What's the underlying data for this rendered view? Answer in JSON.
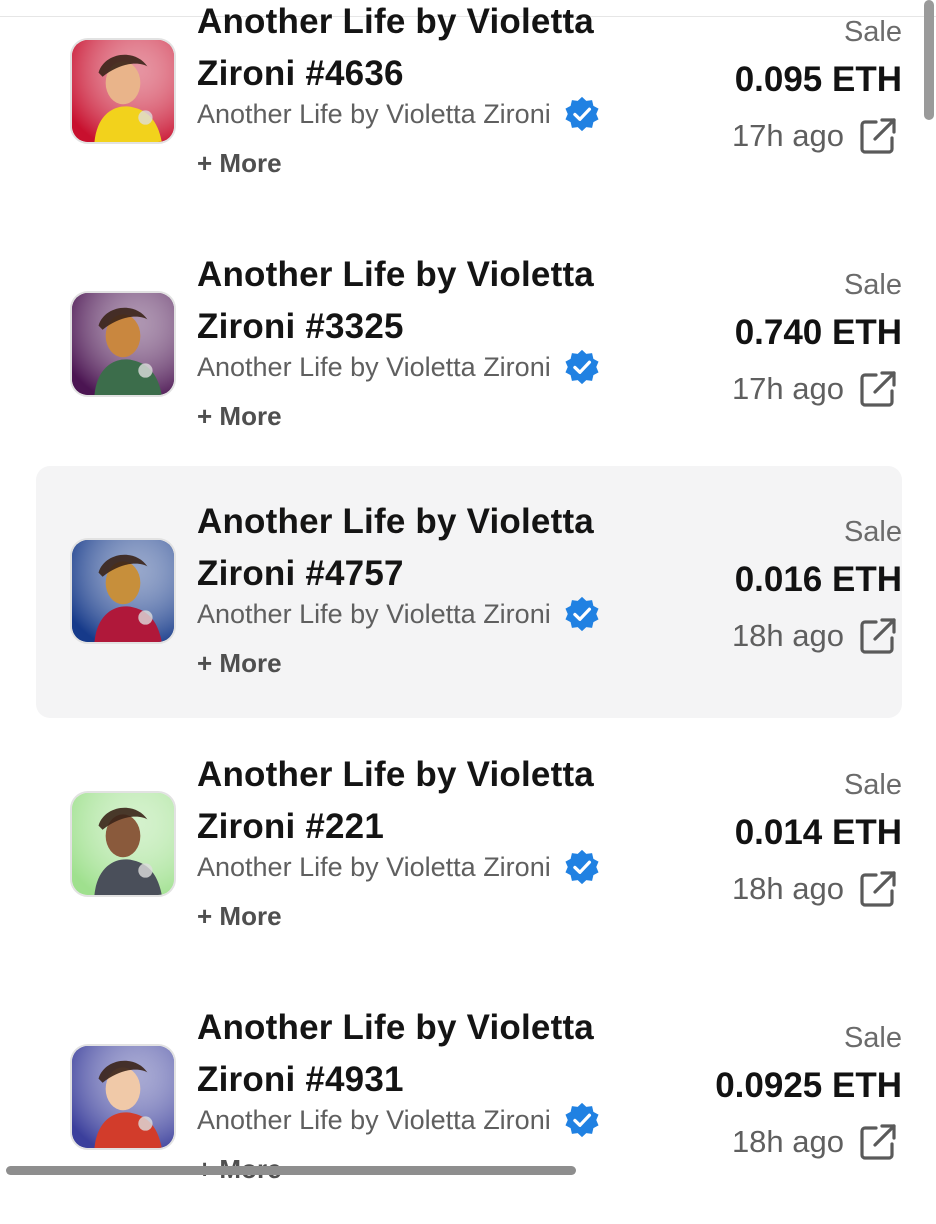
{
  "items": [
    {
      "title_line1": "Another Life by Violetta",
      "title_line2": "Zironi #4636",
      "collection": "Another Life by Violetta Zironi",
      "more": "+ More",
      "event": "Sale",
      "price": "0.095 ETH",
      "time": "17h ago",
      "thumb_bg": "#c8102e",
      "thumb_accent": "#f2d21c",
      "thumb_skin": "#e9b48a"
    },
    {
      "title_line1": "Another Life by Violetta",
      "title_line2": "Zironi #3325",
      "collection": "Another Life by Violetta Zironi",
      "more": "+ More",
      "event": "Sale",
      "price": "0.740 ETH",
      "time": "17h ago",
      "thumb_bg": "#4b1552",
      "thumb_accent": "#3c6d4b",
      "thumb_skin": "#c9873f"
    },
    {
      "title_line1": "Another Life by Violetta",
      "title_line2": "Zironi #4757",
      "collection": "Another Life by Violetta Zironi",
      "more": "+ More",
      "event": "Sale",
      "price": "0.016 ETH",
      "time": "18h ago",
      "thumb_bg": "#163a8a",
      "thumb_accent": "#b0183a",
      "thumb_skin": "#c78f3b"
    },
    {
      "title_line1": "Another Life by Violetta",
      "title_line2": "Zironi #221",
      "collection": "Another Life by Violetta Zironi",
      "more": "+ More",
      "event": "Sale",
      "price": "0.014 ETH",
      "time": "18h ago",
      "thumb_bg": "#9fe08e",
      "thumb_accent": "#4a4f5a",
      "thumb_skin": "#8a5a3c"
    },
    {
      "title_line1": "Another Life by Violetta",
      "title_line2": "Zironi #4931",
      "collection": "Another Life by Violetta Zironi",
      "more": "+ More",
      "event": "Sale",
      "price": "0.0925 ETH",
      "time": "18h ago",
      "thumb_bg": "#3b3f9c",
      "thumb_accent": "#d23c2b",
      "thumb_skin": "#f0c9a8"
    }
  ],
  "colors": {
    "verified": "#2081e2",
    "hover_bg": "#f4f4f5"
  }
}
